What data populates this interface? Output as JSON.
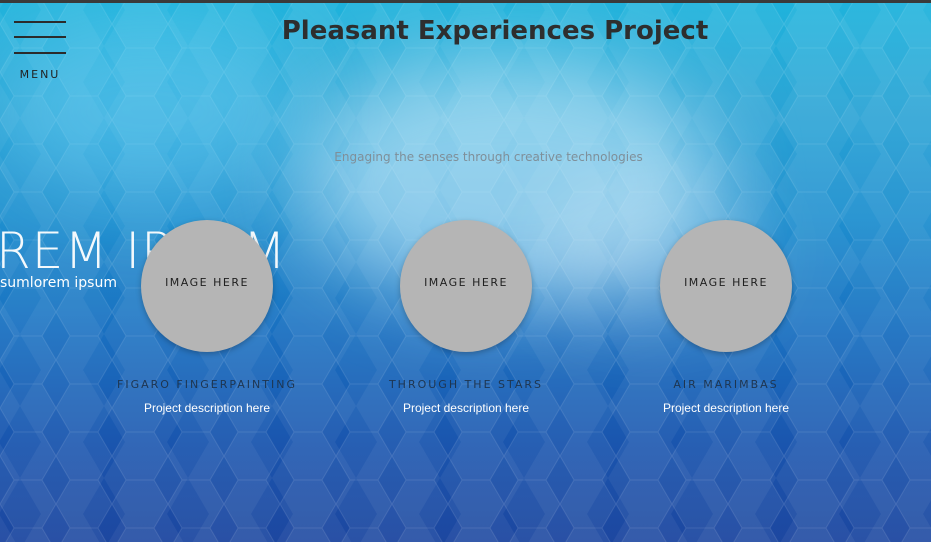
{
  "header": {
    "menu_label": "MENU",
    "title": "Pleasant Experiences Project",
    "tagline": "Engaging the senses through creative technologies"
  },
  "hero": {
    "big_text": "REM IPSUM",
    "small_text": "sumlorem ipsum"
  },
  "projects": [
    {
      "image_label": "IMAGE HERE",
      "title": "FIGARO FINGERPAINTING",
      "description": "Project description here"
    },
    {
      "image_label": "IMAGE HERE",
      "title": "THROUGH THE STARS",
      "description": "Project description here"
    },
    {
      "image_label": "IMAGE HERE",
      "title": "AIR MARIMBAS",
      "description": "Project description here"
    }
  ],
  "colors": {
    "background_top": "#1fb3dc",
    "background_bottom": "#1d47a0",
    "title_text": "#2e2e2e",
    "placeholder_circle": "#b5b5b5",
    "project_title_text": "#1e3550",
    "project_desc_text": "#ffffff"
  },
  "icons": {
    "menu": "hamburger-icon"
  }
}
